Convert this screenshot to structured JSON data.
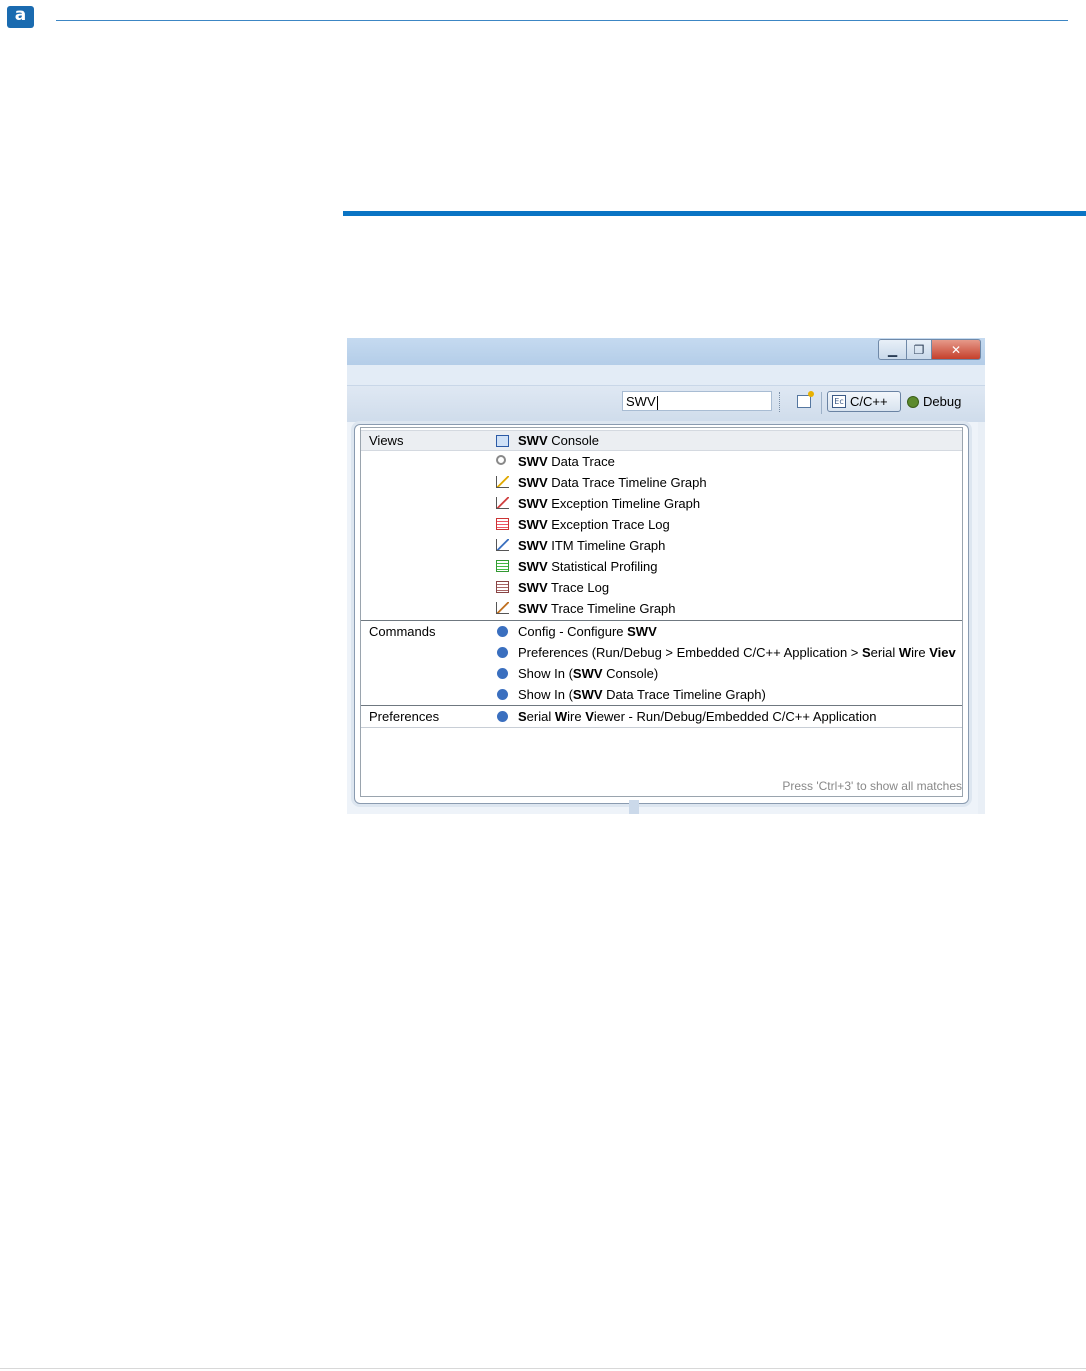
{
  "doc": {
    "logo_letter": "a"
  },
  "window": {
    "min_glyph": "▁",
    "max_glyph": "❐",
    "close_glyph": "✕"
  },
  "toolbar": {
    "search_value": "SWV",
    "perspective_cpp": "C/C++",
    "perspective_cpp_icon": "Ec",
    "perspective_debug": "Debug"
  },
  "popup": {
    "footer": "Press 'Ctrl+3' to show all matches",
    "categories": {
      "views": "Views",
      "commands": "Commands",
      "preferences": "Preferences"
    },
    "views": [
      {
        "bold": "SWV",
        "rest": " Console",
        "icon": "console-icon"
      },
      {
        "bold": "SWV",
        "rest": " Data Trace",
        "icon": "search-icon"
      },
      {
        "bold": "SWV",
        "rest": " Data Trace Timeline Graph",
        "icon": "yellow-graph-icon"
      },
      {
        "bold": "SWV",
        "rest": " Exception Timeline Graph",
        "icon": "red-graph-icon"
      },
      {
        "bold": "SWV",
        "rest": " Exception Trace Log",
        "icon": "red-table-icon"
      },
      {
        "bold": "SWV",
        "rest": " ITM Timeline Graph",
        "icon": "blue-graph-icon"
      },
      {
        "bold": "SWV",
        "rest": " Statistical Profiling",
        "icon": "green-table-icon"
      },
      {
        "bold": "SWV",
        "rest": " Trace Log",
        "icon": "brown-table-icon"
      },
      {
        "bold": "SWV",
        "rest": " Trace Timeline Graph",
        "icon": "orange-graph-icon"
      }
    ],
    "commands": [
      {
        "pre": "Config - Configure ",
        "bold": "SWV",
        "post": ""
      },
      {
        "pre": "Preferences (Run/Debug > Embedded C/C++ Application > ",
        "b1": "S",
        "m1": "erial ",
        "b2": "W",
        "m2": "ire ",
        "b3": "Viev"
      },
      {
        "pre": "Show In (",
        "bold": "SWV",
        "post": " Console)"
      },
      {
        "pre": "Show In (",
        "bold": "SWV",
        "post": " Data Trace Timeline Graph)"
      }
    ],
    "preferences": [
      {
        "b1": "S",
        "m1": "erial ",
        "b2": "W",
        "m2": "ire ",
        "b3": "V",
        "post": "iewer - Run/Debug/Embedded C/C++ Application"
      }
    ]
  },
  "colors": {
    "accent": "#0a74c4",
    "logo": "#1a6bb0",
    "bullet": "#3a6fbf"
  }
}
